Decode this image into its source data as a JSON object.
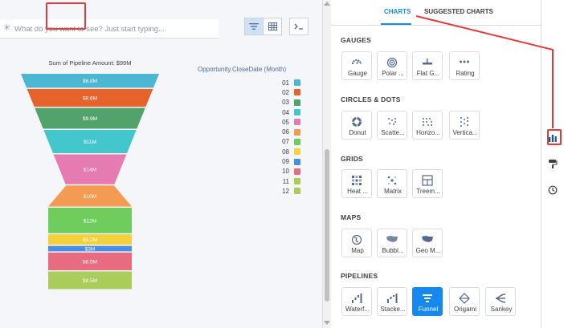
{
  "query": {
    "placeholder": "What do you want to see? Just start typing..."
  },
  "view_toggles": [
    "filter-icon",
    "table-icon",
    "sql-icon"
  ],
  "chart": {
    "title": "Sum of Pipeline Amount: $99M",
    "legend_title": "Opportunity.CloseDate (Month)"
  },
  "chart_data": {
    "type": "funnel",
    "title": "Sum of Pipeline Amount: $99M",
    "total": "$99M",
    "legend_title": "Opportunity.CloseDate (Month)",
    "categories": [
      "01",
      "02",
      "03",
      "04",
      "05",
      "06",
      "07",
      "08",
      "09",
      "10",
      "11",
      "12"
    ],
    "values": [
      6.8,
      8.6,
      9.9,
      11,
      14,
      10,
      12,
      5.2,
      3,
      8.5,
      8.5,
      0
    ],
    "value_labels": [
      "$6.8M",
      "$8.6M",
      "$9.9M",
      "$11M",
      "$14M",
      "$10M",
      "$12M",
      "$5.2M",
      "$3M",
      "$8.5M",
      "$8.5M",
      ""
    ],
    "colors": [
      "#4bb7d3",
      "#e6642c",
      "#52a36b",
      "#44c7cc",
      "#e57bb0",
      "#f39a53",
      "#6fcd5e",
      "#f4d13a",
      "#4a8ee3",
      "#e96b7f",
      "#a9cc5a",
      "#a9cc5a"
    ]
  },
  "tabs": {
    "charts": "CHARTS",
    "suggested": "SUGGESTED CHARTS"
  },
  "sections": {
    "gauges": {
      "title": "GAUGES",
      "items": [
        {
          "label": "Gauge"
        },
        {
          "label": "Polar ..."
        },
        {
          "label": "Flat G..."
        },
        {
          "label": "Rating"
        }
      ]
    },
    "circles": {
      "title": "CIRCLES & DOTS",
      "items": [
        {
          "label": "Donut"
        },
        {
          "label": "Scatte..."
        },
        {
          "label": "Horizo..."
        },
        {
          "label": "Vertica..."
        }
      ]
    },
    "grids": {
      "title": "GRIDS",
      "items": [
        {
          "label": "Heat ..."
        },
        {
          "label": "Matrix"
        },
        {
          "label": "Treem..."
        }
      ]
    },
    "maps": {
      "title": "MAPS",
      "items": [
        {
          "label": "Map"
        },
        {
          "label": "Bubbl..."
        },
        {
          "label": "Geo M..."
        }
      ]
    },
    "pipelines": {
      "title": "PIPELINES",
      "items": [
        {
          "label": "Waterf..."
        },
        {
          "label": "Stacke..."
        },
        {
          "label": "Funnel"
        },
        {
          "label": "Origami"
        },
        {
          "label": "Sankey"
        }
      ]
    }
  },
  "rail": [
    "chart-type-icon",
    "format-paint-icon",
    "history-icon"
  ],
  "accent": "#1589ee",
  "highlight": "#e03c3c"
}
